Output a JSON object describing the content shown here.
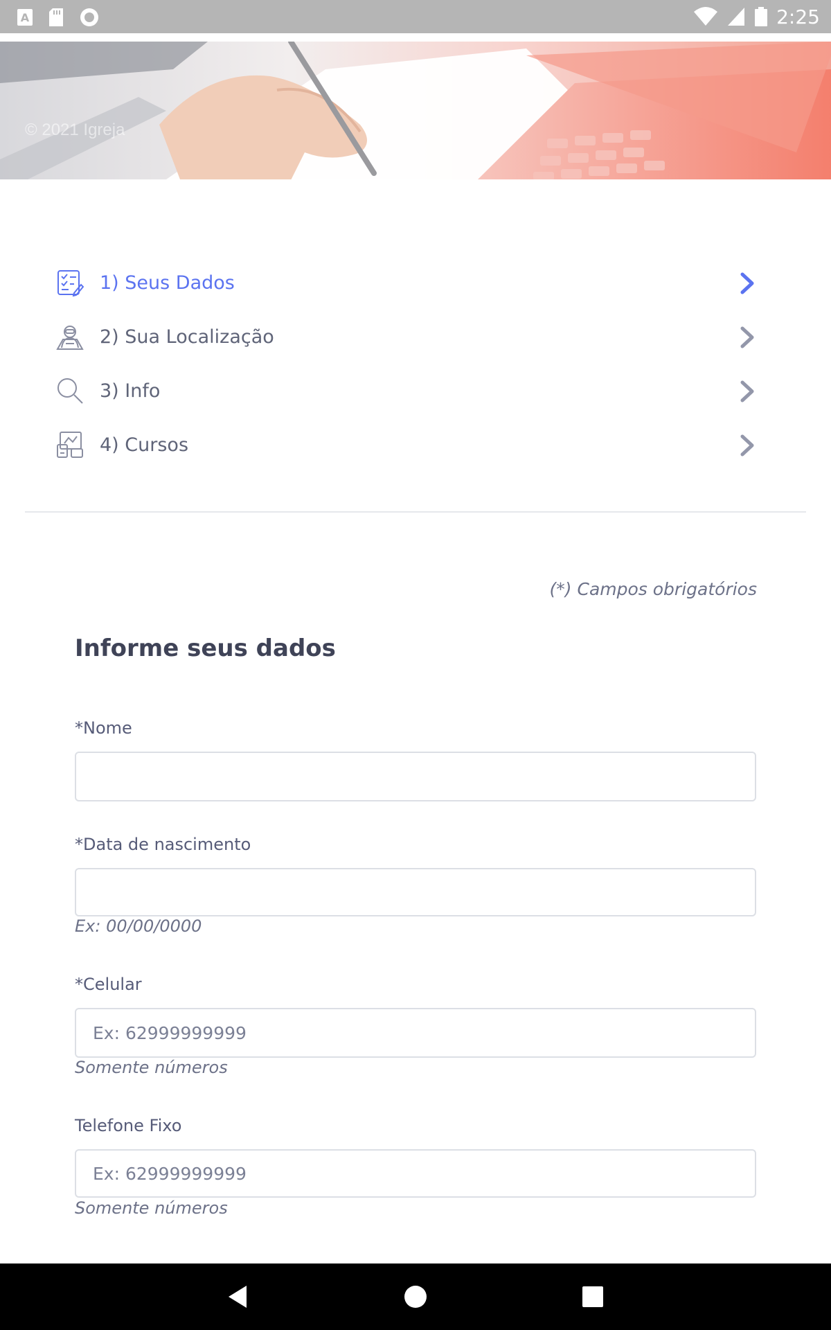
{
  "status_bar": {
    "time": "2:25",
    "icons": [
      "a-keyboard-icon",
      "sd-card-icon",
      "circle-record-icon",
      "wifi-icon",
      "signal-icon",
      "battery-icon"
    ]
  },
  "banner": {
    "caption": "© 2021 Igreja"
  },
  "steps": [
    {
      "label": "1) Seus Dados",
      "icon": "form-checklist-icon",
      "active": true
    },
    {
      "label": "2) Sua Localização",
      "icon": "location-person-icon",
      "active": false
    },
    {
      "label": "3) Info",
      "icon": "search-icon",
      "active": false
    },
    {
      "label": "4) Cursos",
      "icon": "courses-devices-icon",
      "active": false
    }
  ],
  "form": {
    "required_note": "(*) Campos obrigatórios",
    "title": "Informe seus dados",
    "fields": {
      "nome": {
        "label": "*Nome",
        "value": "",
        "placeholder": ""
      },
      "nascimento": {
        "label": "*Data de nascimento",
        "value": "",
        "placeholder": "",
        "help": "Ex: 00/00/0000"
      },
      "celular": {
        "label": "*Celular",
        "value": "",
        "placeholder": "Ex: 62999999999",
        "help": "Somente números"
      },
      "telefone": {
        "label": "Telefone Fixo",
        "value": "",
        "placeholder": "Ex: 62999999999",
        "help": "Somente números"
      }
    }
  },
  "colors": {
    "accent": "#5b73f0",
    "text": "#5f6478",
    "chevron_inactive": "#9397aa",
    "status_bar": "#b5b5b5",
    "nav_bar": "#000000"
  },
  "nav_bar": {
    "buttons": [
      "back-icon",
      "home-icon",
      "recents-icon"
    ]
  }
}
